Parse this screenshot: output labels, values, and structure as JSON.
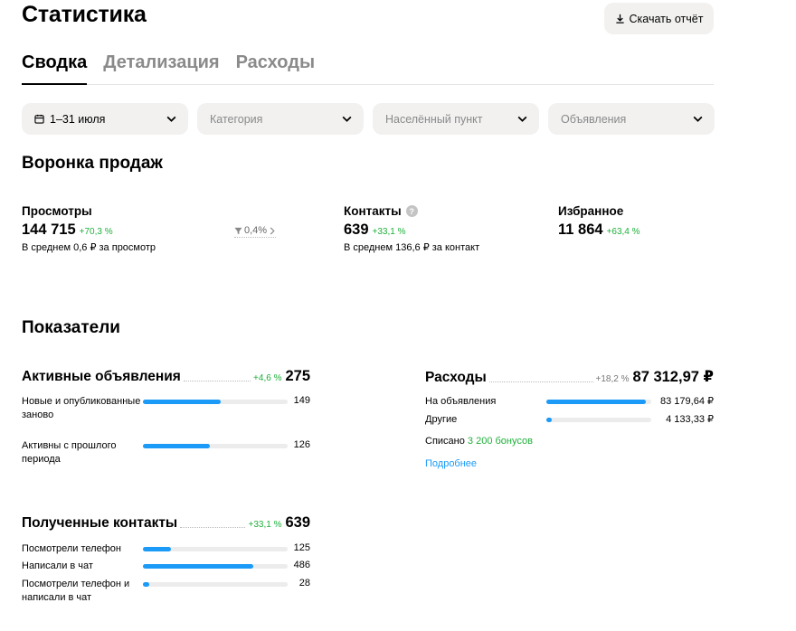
{
  "header": {
    "title": "Статистика",
    "download_label": "Скачать отчёт"
  },
  "tabs": [
    {
      "label": "Сводка",
      "active": true
    },
    {
      "label": "Детализация",
      "active": false
    },
    {
      "label": "Расходы",
      "active": false
    }
  ],
  "filters": {
    "period": "1–31 июля",
    "category_placeholder": "Категория",
    "location_placeholder": "Населённый пункт",
    "ads_placeholder": "Объявления"
  },
  "funnel": {
    "title": "Воронка продаж",
    "views": {
      "label": "Просмотры",
      "value": "144 715",
      "delta": "+70,3 %",
      "sub": "В среднем 0,6 ₽ за просмотр",
      "conversion": "0,4%"
    },
    "contacts": {
      "label": "Контакты",
      "value": "639",
      "delta": "+33,1 %",
      "sub": "В среднем 136,6 ₽ за контакт",
      "help": "?"
    },
    "favorites": {
      "label": "Избранное",
      "value": "11 864",
      "delta": "+63,4 %"
    }
  },
  "indicators": {
    "title": "Показатели",
    "active_ads": {
      "title": "Активные объявления",
      "delta": "+4,6 %",
      "total": "275",
      "rows": [
        {
          "label": "Новые и опубликованные заново",
          "value": "149",
          "fraction": 0.54
        },
        {
          "label": "Активны с прошлого периода",
          "value": "126",
          "fraction": 0.46
        }
      ]
    },
    "expenses": {
      "title": "Расходы",
      "delta": "+18,2 %",
      "total": "87 312,97 ₽",
      "rows": [
        {
          "label": "На объявления",
          "value": "83 179,64 ₽",
          "fraction": 0.95
        },
        {
          "label": "Другие",
          "value": "4 133,33 ₽",
          "fraction": 0.05
        }
      ],
      "spent_prefix": "Списано",
      "spent_bonus": "3 200 бонусов",
      "more_link": "Подробнее"
    },
    "contacts": {
      "title": "Полученные контакты",
      "delta": "+33,1 %",
      "total": "639",
      "rows": [
        {
          "label": "Посмотрели телефон",
          "value": "125",
          "fraction": 0.196
        },
        {
          "label": "Написали в чат",
          "value": "486",
          "fraction": 0.76
        },
        {
          "label": "Посмотрели телефон и написали в чат",
          "value": "28",
          "fraction": 0.044
        }
      ]
    }
  },
  "colors": {
    "accent_blue": "#1b9af7",
    "positive_green": "#1eb03a",
    "chip_bg": "#f2f1f0"
  }
}
